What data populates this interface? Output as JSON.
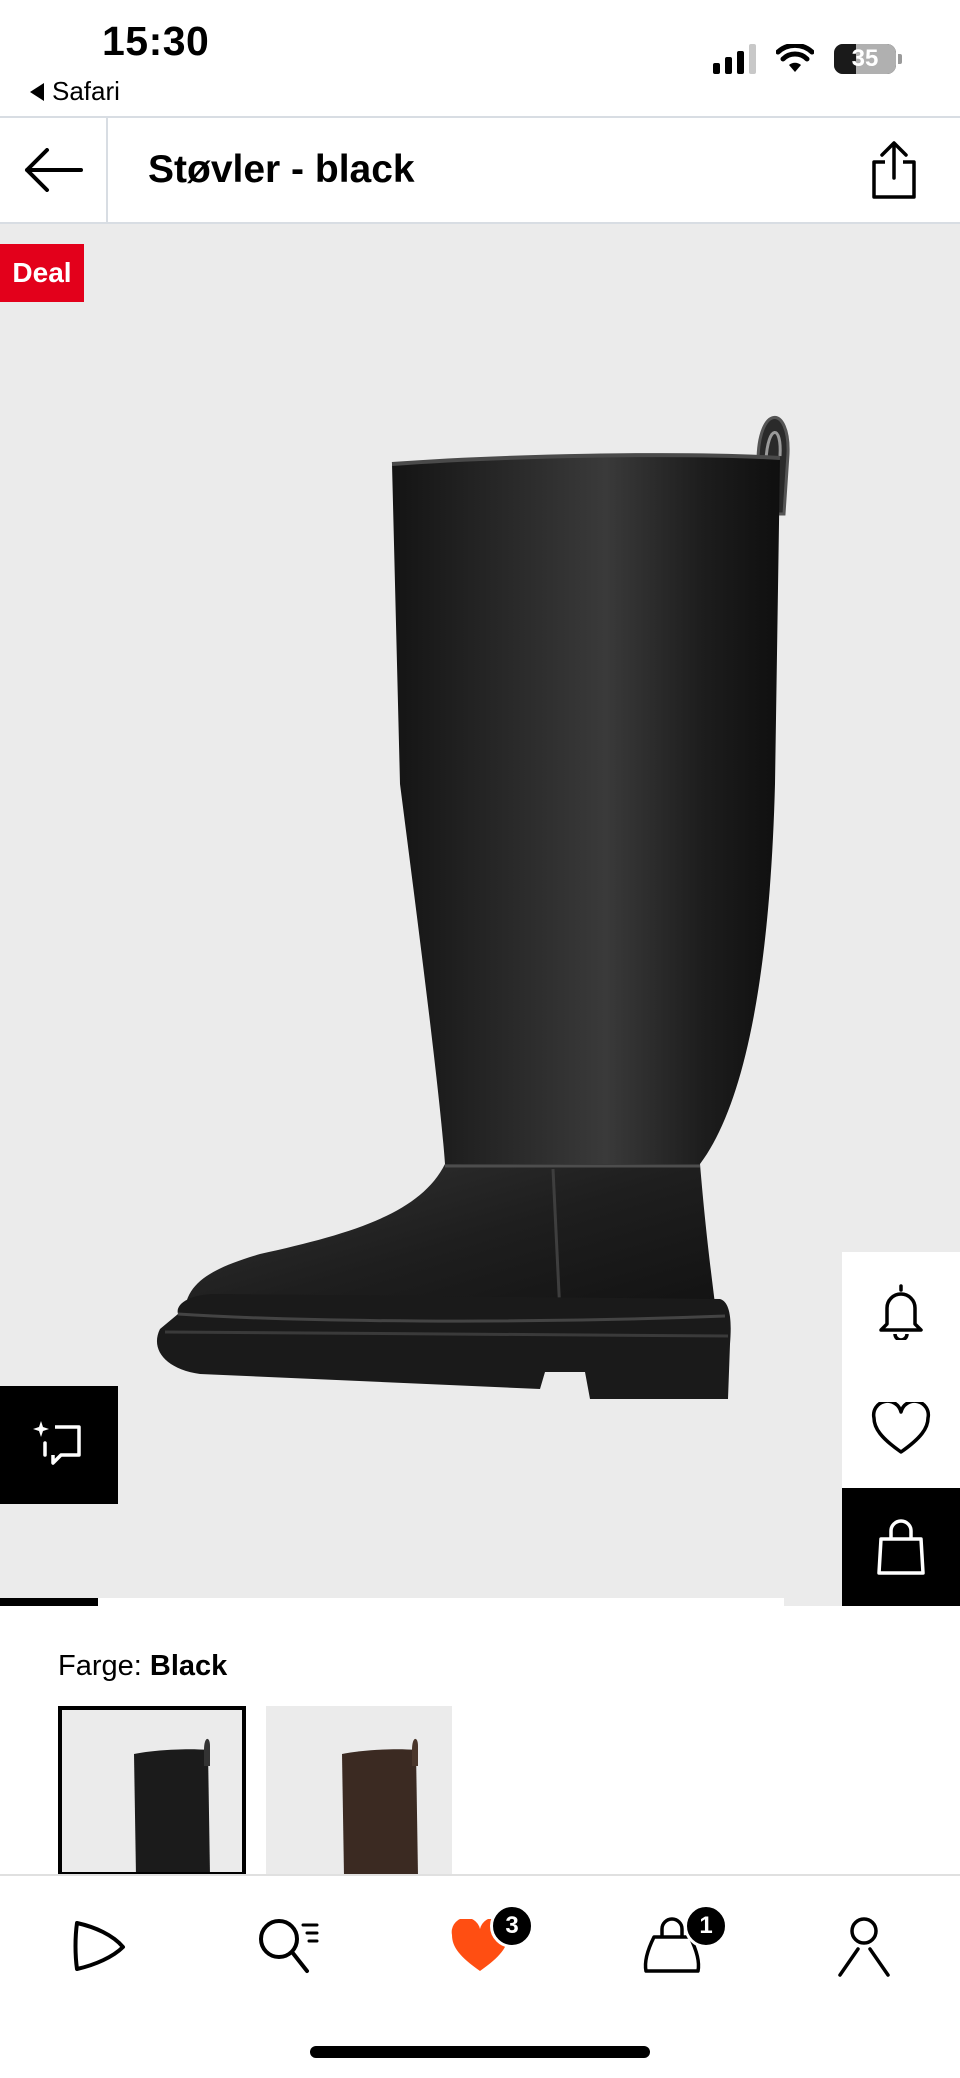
{
  "status_bar": {
    "time": "15:30",
    "back_app": "Safari",
    "battery": "35",
    "battery_level": 0.35
  },
  "header": {
    "title": "Støvler - black",
    "back_icon": "arrow-left-icon",
    "share_icon": "share-icon"
  },
  "product": {
    "deal_label": "Deal",
    "image_progress": 0.125
  },
  "side_actions": {
    "notify_icon": "bell-icon",
    "wishlist_icon": "heart-icon",
    "cart_icon": "shopping-bag-icon"
  },
  "color": {
    "label": "Farge:",
    "selected": "Black",
    "options": [
      "Black",
      "Brown"
    ]
  },
  "tabbar": {
    "items": [
      {
        "name": "home",
        "icon": "play-logo-icon"
      },
      {
        "name": "search",
        "icon": "search-icon"
      },
      {
        "name": "wishlist",
        "icon": "heart-filled-icon",
        "badge": "3"
      },
      {
        "name": "cart",
        "icon": "shopping-bag-icon",
        "badge": "1"
      },
      {
        "name": "account",
        "icon": "user-icon"
      }
    ]
  },
  "colors": {
    "deal_red": "#e3001b",
    "wishlist_orange": "#ff4e12",
    "image_background": "#ebebeb"
  }
}
